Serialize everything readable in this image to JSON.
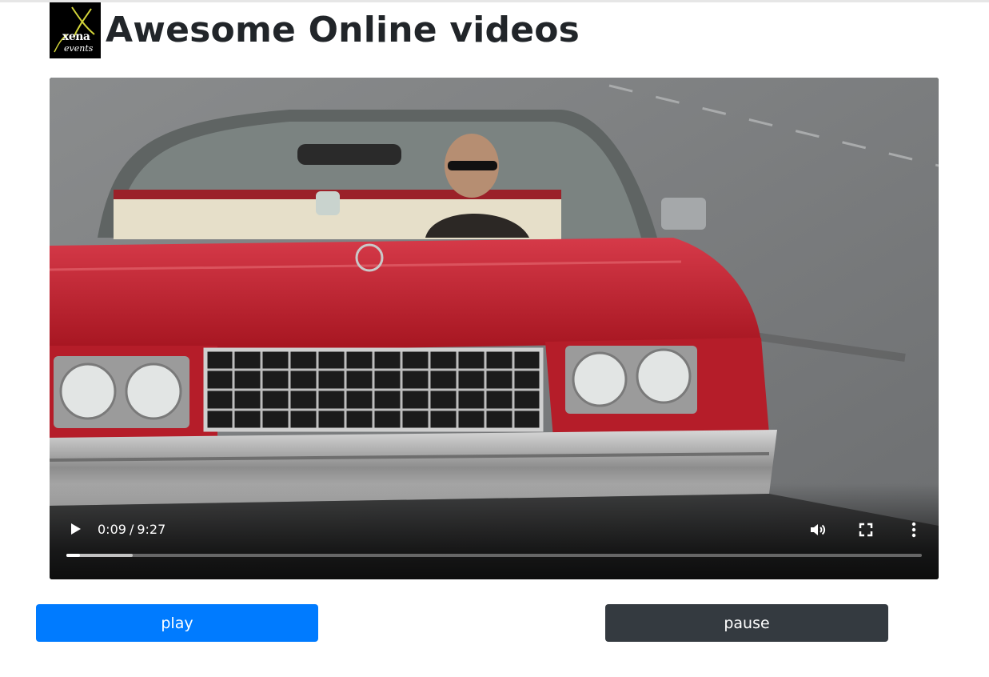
{
  "header": {
    "title": "Awesome Online videos",
    "logo": {
      "word": "xena",
      "sub": "events"
    }
  },
  "video": {
    "current_time": "0:09",
    "separator": "/",
    "duration": "9:27",
    "played_fraction": 0.016,
    "buffered_fraction": 0.078,
    "icons": [
      "play-icon",
      "volume-icon",
      "fullscreen-icon",
      "more-options-icon"
    ]
  },
  "buttons": {
    "play_label": "play",
    "pause_label": "pause"
  },
  "colors": {
    "play_button": "#007bff",
    "pause_button": "#343a40",
    "title_text": "#212529"
  }
}
